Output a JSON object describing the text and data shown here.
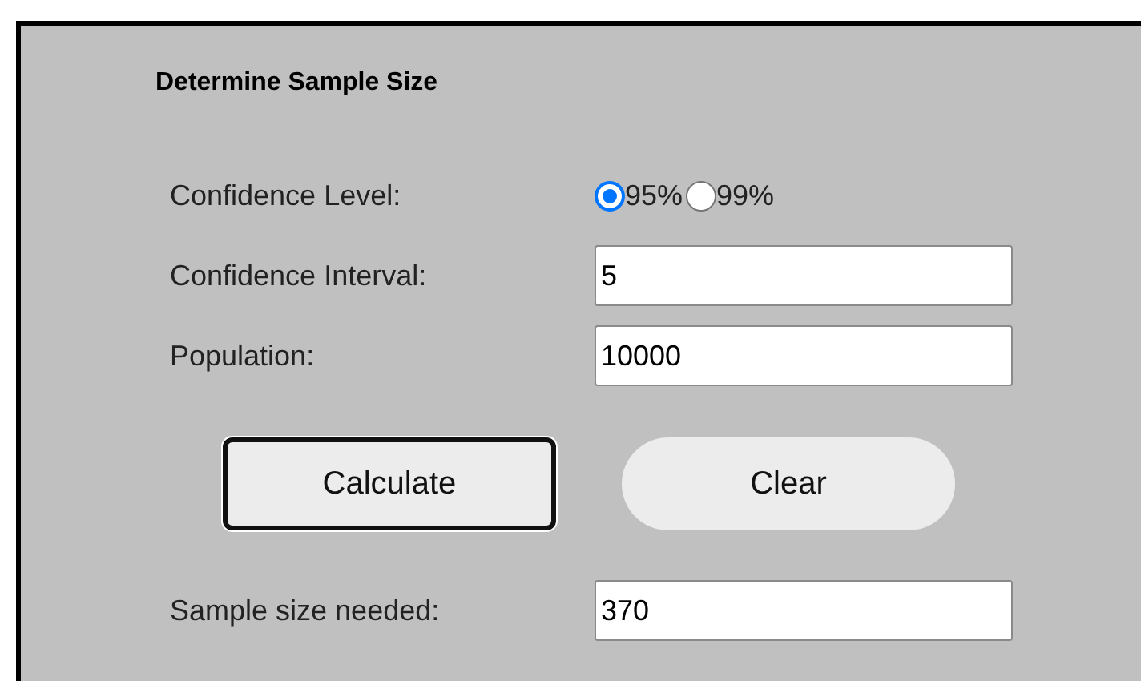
{
  "title": "Determine Sample Size",
  "rows": [
    {
      "kind": "radio",
      "label": "Confidence Level:",
      "options": [
        {
          "label": "95%",
          "selected": true
        },
        {
          "label": "99%",
          "selected": false
        }
      ]
    },
    {
      "kind": "input",
      "label": "Confidence Interval:",
      "value": "5"
    },
    {
      "kind": "input",
      "label": "Population:",
      "value": "10000"
    }
  ],
  "buttons": [
    {
      "label": "Calculate",
      "focused": true
    },
    {
      "label": "Clear",
      "focused": false
    }
  ],
  "result": {
    "label": "Sample size needed:",
    "value": "370"
  }
}
